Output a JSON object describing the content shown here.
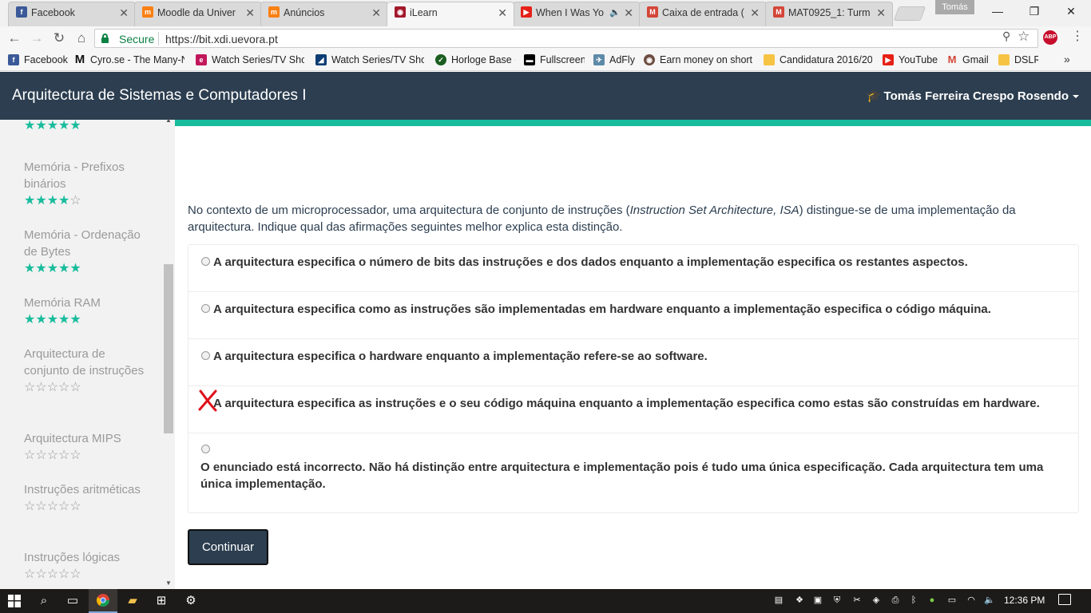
{
  "browser": {
    "tabs": [
      {
        "title": "Facebook",
        "icon": "facebook-icon",
        "color": "#3b5998",
        "glyph": "f"
      },
      {
        "title": "Moodle da Univer",
        "icon": "moodle-icon",
        "color": "#f98012",
        "glyph": "m"
      },
      {
        "title": "Anúncios",
        "icon": "moodle-icon",
        "color": "#f98012",
        "glyph": "m"
      },
      {
        "title": "iLearn",
        "icon": "ilearn-icon",
        "color": "#a3192b",
        "glyph": "◉"
      },
      {
        "title": "When I Was Yo",
        "icon": "youtube-icon",
        "color": "#e62117",
        "glyph": "▶"
      },
      {
        "title": "Caixa de entrada (",
        "icon": "gmail-icon",
        "color": "#d44638",
        "glyph": "M"
      },
      {
        "title": "MAT0925_1: Turm",
        "icon": "gmail-icon",
        "color": "#d44638",
        "glyph": "M"
      }
    ],
    "profile_name": "Tomás",
    "secure_label": "Secure",
    "url": "https://bit.xdi.uevora.pt",
    "bookmarks": [
      {
        "label": "Facebook",
        "icon": "facebook-icon",
        "color": "#3b5998",
        "glyph": "f"
      },
      {
        "label": "Cyro.se - The Many-N",
        "icon": "cyro-icon",
        "color": "#111111",
        "glyph": "M"
      },
      {
        "label": "Watch Series/TV Shov",
        "icon": "series-icon",
        "color": "#c2185b",
        "glyph": "e"
      },
      {
        "label": "Watch Series/TV Shov",
        "icon": "series-icon",
        "color": "#0d3d73",
        "glyph": "◢"
      },
      {
        "label": "Horloge Base -",
        "icon": "check-icon",
        "color": "#1b5e20",
        "glyph": "✓"
      },
      {
        "label": "Fullscreen",
        "icon": "fullscreen-icon",
        "color": "#000000",
        "glyph": "▬"
      },
      {
        "label": "AdFly",
        "icon": "adfly-icon",
        "color": "#5d8aa8",
        "glyph": "✈"
      },
      {
        "label": "Earn money on short l",
        "icon": "earn-icon",
        "color": "#6d4c41",
        "glyph": "◉"
      },
      {
        "label": "Candidatura 2016/20",
        "icon": "folder-icon",
        "color": "#f6c343",
        "glyph": ""
      },
      {
        "label": "YouTube",
        "icon": "youtube-icon",
        "color": "#e62117",
        "glyph": "▶"
      },
      {
        "label": "Gmail",
        "icon": "gmail-icon",
        "color": "#d44638",
        "glyph": "M"
      },
      {
        "label": "DSLR",
        "icon": "folder-icon",
        "color": "#f6c343",
        "glyph": ""
      }
    ],
    "more_bookmarks": "»"
  },
  "header": {
    "title": "Arquitectura de Sistemas e Computadores I",
    "user_name": "Tomás Ferreira Crespo Rosendo"
  },
  "sidebar": {
    "items": [
      {
        "label": "",
        "rating": 5
      },
      {
        "label": "Memória - Prefixos binários",
        "rating": 4
      },
      {
        "label": "Memória - Ordenação de Bytes",
        "rating": 5
      },
      {
        "label": "Memória RAM",
        "rating": 5
      },
      {
        "label": "Arquitectura de conjunto de instruções",
        "rating": 0
      },
      {
        "label": "Arquitectura MIPS",
        "rating": 0
      },
      {
        "label": "Instruções aritméticas",
        "rating": 0
      },
      {
        "label": "Instruções lógicas",
        "rating": 0
      }
    ]
  },
  "question": {
    "text_before": "No contexto de um microprocessador, uma arquitectura de conjunto de instruções (",
    "text_em": "Instruction Set Architecture, ISA",
    "text_after": ") distingue-se de uma implementação da arquitectura. Indique qual das afirmações seguintes melhor explica esta distinção.",
    "options": [
      {
        "text": "A arquitectura especifica o número de bits das instruções e dos dados enquanto a implementação especifica os restantes aspectos.",
        "state": "unselected"
      },
      {
        "text": "A arquitectura especifica como as instruções são implementadas em hardware enquanto a implementação especifica o código máquina.",
        "state": "unselected"
      },
      {
        "text": "A arquitectura especifica o hardware enquanto a implementação refere-se ao software.",
        "state": "unselected"
      },
      {
        "text": "A arquitectura especifica as instruções e o seu código máquina enquanto a implementação especifica como estas são construídas em hardware.",
        "state": "wrong"
      },
      {
        "text": "O enunciado está incorrecto. Não há distinção entre arquitectura e implementação pois é tudo uma única especificação. Cada arquitectura tem uma única implementação.",
        "state": "unselected"
      }
    ],
    "continue_label": "Continuar"
  },
  "colors": {
    "header_bg": "#2c3e50",
    "accent": "#18bc9c",
    "wrong_mark": "#e0101a"
  },
  "taskbar": {
    "time": "12:36 PM"
  }
}
